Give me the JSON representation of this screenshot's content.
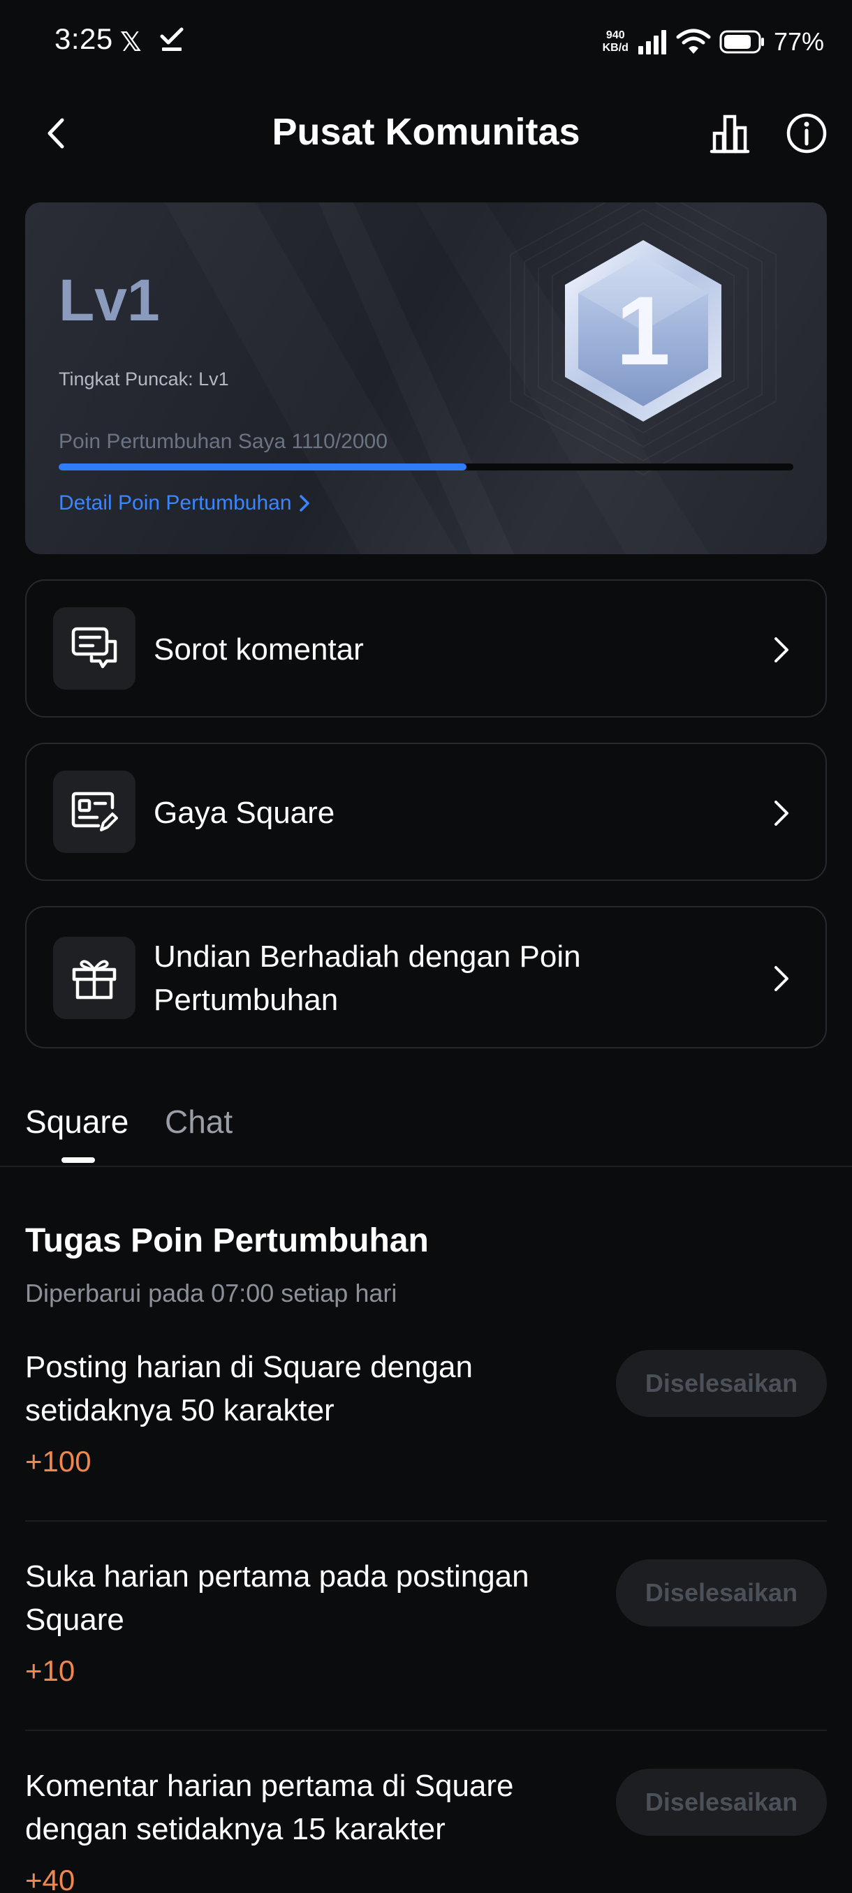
{
  "status_bar": {
    "time": "3:25",
    "x_glyph": "𝕏",
    "net_speed_value": "940",
    "net_speed_unit": "KB/d",
    "battery": "77%"
  },
  "header": {
    "title": "Pusat Komunitas",
    "back_icon": "chevron-left-icon",
    "stats_icon": "bar-chart-icon",
    "info_icon": "info-icon"
  },
  "level_card": {
    "level": "Lv1",
    "peak_level": "Tingkat Puncak: Lv1",
    "growth_points": "Poin Pertumbuhan Saya 1110/2000",
    "progress_current": 1110,
    "progress_max": 2000,
    "detail_link": "Detail Poin Pertumbuhan",
    "badge_number": "1",
    "accent_color": "#2f7cf6"
  },
  "menu": [
    {
      "label": "Sorot komentar",
      "icon": "comment-icon"
    },
    {
      "label": "Gaya Square",
      "icon": "profile-card-edit-icon"
    },
    {
      "label_line1": "Undian Berhadiah dengan Poin",
      "label_line2": "Pertumbuhan",
      "icon": "gift-icon"
    }
  ],
  "tabs": [
    {
      "label": "Square",
      "active": true
    },
    {
      "label": "Chat",
      "active": false
    }
  ],
  "tasks_section": {
    "title": "Tugas Poin Pertumbuhan",
    "subtitle": "Diperbarui pada 07:00 setiap hari",
    "items": [
      {
        "line1": "Posting harian di Square dengan",
        "line2": "setidaknya 50 karakter",
        "points": "+100",
        "button": "Diselesaikan"
      },
      {
        "line1": "Suka harian pertama pada postingan",
        "line2": "Square",
        "points": "+10",
        "button": "Diselesaikan"
      },
      {
        "line1": "Komentar harian pertama di Square",
        "line2": "dengan setidaknya 15 karakter",
        "points": "+40",
        "button": "Diselesaikan"
      }
    ],
    "points_color": "#f0884e"
  }
}
